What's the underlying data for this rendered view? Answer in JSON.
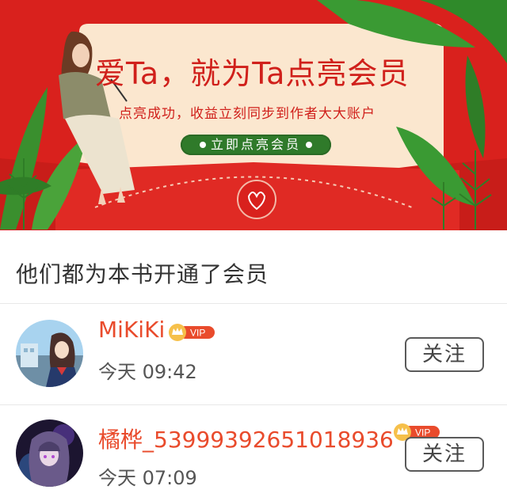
{
  "banner": {
    "title": "爱Ta，就为Ta点亮会员",
    "subtitle": "点亮成功，收益立刻同步到作者大大账户",
    "cta_label": "立即点亮会员",
    "bg_color": "#d9211d",
    "accent_green": "#2f7a2a"
  },
  "section": {
    "title": "他们都为本书开通了会员"
  },
  "members": [
    {
      "name": "MiKiKi",
      "badge": "VIP",
      "time": "今天 09:42",
      "follow_label": "关注",
      "avatar_icon": "anime-girl-avatar"
    },
    {
      "name": "橘桦_5399939265101893​6",
      "badge": "VIP",
      "time": "今天 07:09",
      "follow_label": "关注",
      "avatar_icon": "anime-girl-dark-avatar"
    }
  ]
}
